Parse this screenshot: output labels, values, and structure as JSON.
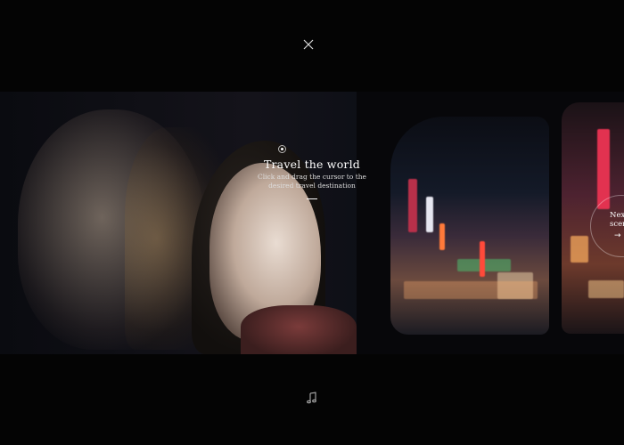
{
  "overlay": {
    "title": "Travel the world",
    "subtitle": "Click and drag the cursor to the desired travel destination"
  },
  "next_scene": {
    "label": "Next scene",
    "arrow": "→"
  },
  "icons": {
    "close": "close-icon",
    "music": "music-note-icon",
    "next": "arrow-right-icon"
  },
  "colors": {
    "background": "#040404",
    "text": "#ffffff"
  }
}
